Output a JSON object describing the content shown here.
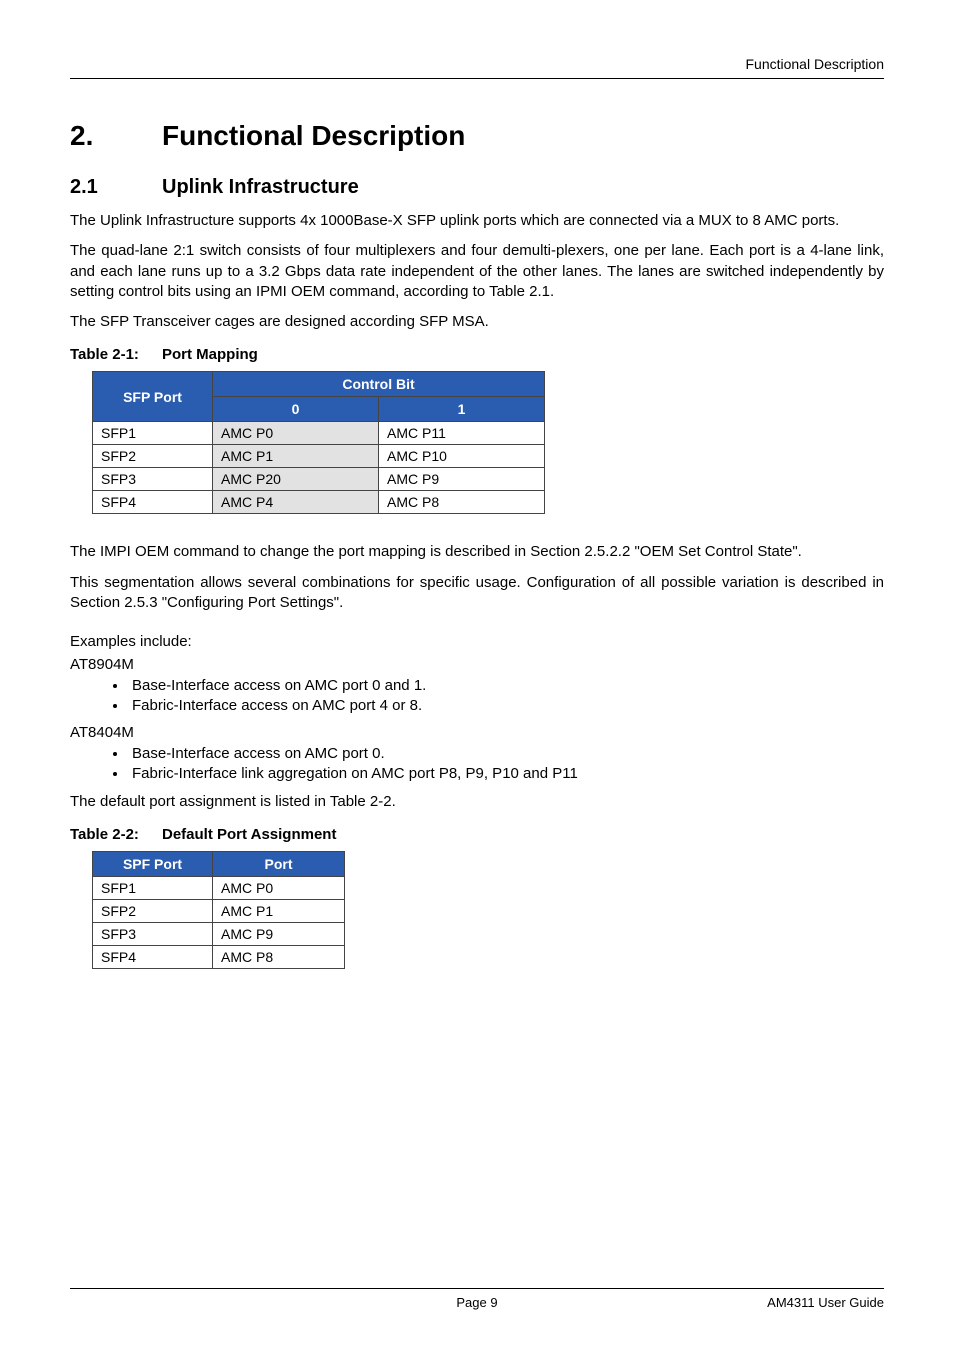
{
  "header": {
    "running_title": "Functional Description"
  },
  "chapter": {
    "number": "2.",
    "title": "Functional Description"
  },
  "section": {
    "number": "2.1",
    "title": "Uplink Infrastructure"
  },
  "paragraphs": {
    "p1": "The Uplink Infrastructure supports 4x 1000Base-X SFP uplink ports which are connected via a MUX to 8 AMC ports.",
    "p2": "The quad-lane 2:1 switch consists of four multiplexers and four demulti-plexers, one per lane. Each port is a 4-lane link, and each lane runs up to a 3.2 Gbps data rate independent of the other lanes. The lanes are switched independently by setting control bits using an IPMI OEM command, according to Table 2.1.",
    "p3": "The SFP Transceiver cages are designed according SFP MSA.",
    "p4": "The IMPI OEM command to change the port mapping is described in Section 2.5.2.2 \"OEM Set Control State\".",
    "p5": "This segmentation allows several combinations for specific usage. Configuration of  all possible variation is described in Section 2.5.3 \"Configuring Port Settings\".",
    "examples_intro": "Examples include:",
    "model1": "AT8904M",
    "model1_b1": "Base-Interface access on AMC port 0 and 1.",
    "model1_b2": "Fabric-Interface access on AMC port 4 or 8.",
    "model2": "AT8404M",
    "model2_b1": "Base-Interface access on AMC port 0.",
    "model2_b2": "Fabric-Interface link aggregation on AMC port P8, P9, P10 and P11",
    "p6": "The default port assignment is listed in Table 2-2."
  },
  "table1": {
    "caption_num": "Table 2-1:",
    "caption_title": "Port Mapping",
    "head_sfp": "SFP Port",
    "head_ctrl": "Control Bit",
    "head_0": "0",
    "head_1": "1",
    "rows": [
      {
        "sfp": "SFP1",
        "c0": "AMC P0",
        "c1": "AMC P11"
      },
      {
        "sfp": "SFP2",
        "c0": "AMC P1",
        "c1": "AMC P10"
      },
      {
        "sfp": "SFP3",
        "c0": "AMC P20",
        "c1": "AMC P9"
      },
      {
        "sfp": "SFP4",
        "c0": "AMC P4",
        "c1": "AMC P8"
      }
    ]
  },
  "table2": {
    "caption_num": "Table 2-2:",
    "caption_title": "Default Port Assignment",
    "head_spf": "SPF Port",
    "head_port": "Port",
    "rows": [
      {
        "spf": "SFP1",
        "port": "AMC P0"
      },
      {
        "spf": "SFP2",
        "port": "AMC P1"
      },
      {
        "spf": "SFP3",
        "port": "AMC P9"
      },
      {
        "spf": "SFP4",
        "port": "AMC P8"
      }
    ]
  },
  "footer": {
    "page": "Page 9",
    "doc": "AM4311 User Guide"
  }
}
